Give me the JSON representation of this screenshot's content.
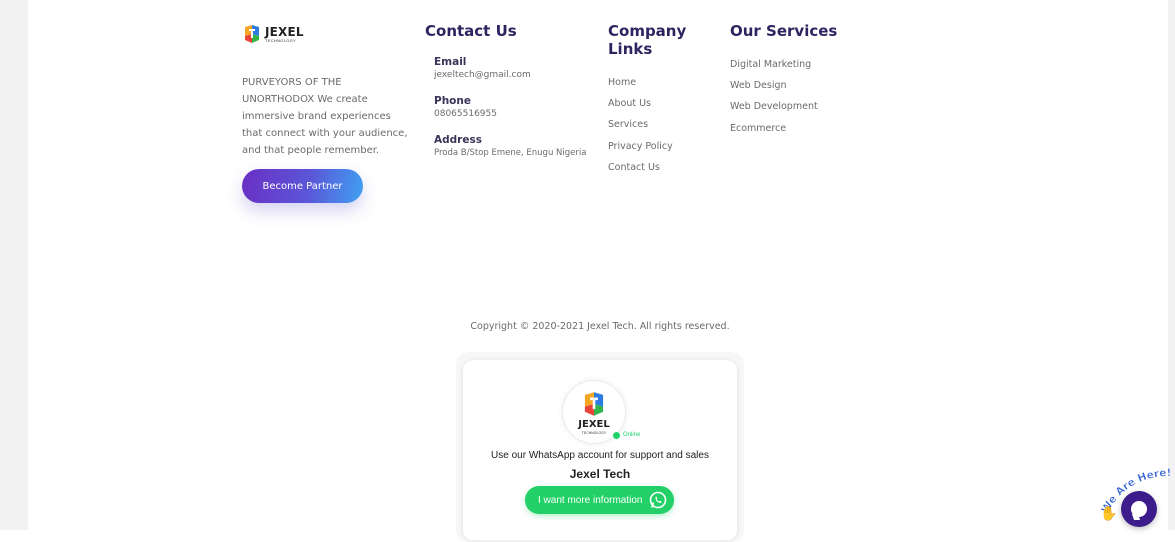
{
  "brand": {
    "logo_name": "JEXEL",
    "logo_sub": "TECHNOLOGY",
    "description": "PURVEYORS OF THE UNORTHODOX We create immersive brand experiences that connect with your audience, and that people remember.",
    "partner_button": "Become Partner"
  },
  "contact": {
    "title": "Contact Us",
    "email_label": "Email",
    "email": "jexeltech@gmail.com",
    "phone_label": "Phone",
    "phone": "08065516955",
    "address_label": "Address",
    "address": "Proda B/Stop Emene, Enugu Nigeria"
  },
  "company_links": {
    "title": "Company Links",
    "items": [
      "Home",
      "About Us",
      "Services",
      "Privacy Policy",
      "Contact Us"
    ]
  },
  "services": {
    "title": "Our Services",
    "items": [
      "Digital Marketing",
      "Web Design",
      "Web Development",
      "Ecommerce"
    ]
  },
  "copyright": "Copyright © 2020-2021 Jexel Tech. All rights reserved.",
  "whatsapp": {
    "avatar_name": "JEXEL",
    "avatar_sub": "TECHNOLOGY",
    "status": "Online",
    "message": "Use our WhatsApp account for support and sales",
    "company": "Jexel Tech",
    "button": "I want more information"
  },
  "chat_widget": {
    "badge": "We Are Here!"
  },
  "colors": {
    "heading": "#2c2560",
    "text": "#6b6b6b",
    "whatsapp_green": "#22d067",
    "partner_gradient_start": "#6a2fc4",
    "partner_gradient_end": "#3fa1f2",
    "chat_button": "#3d1d8c"
  },
  "icons": [
    "jexel-logo-icon",
    "whatsapp-icon",
    "chat-icon",
    "wave-hand-icon"
  ]
}
